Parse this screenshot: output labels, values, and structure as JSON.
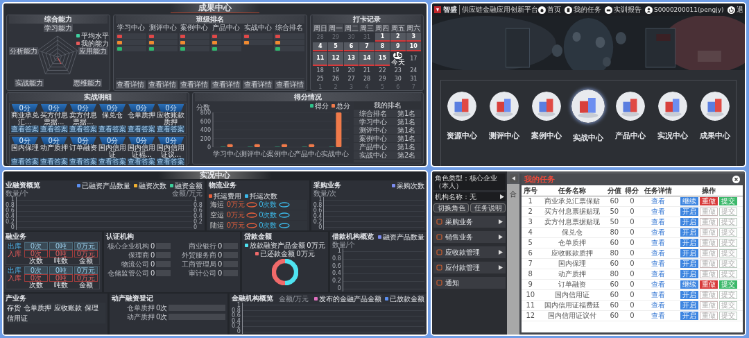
{
  "achievement": {
    "title": "成果中心",
    "ability": {
      "title": "综合能力",
      "axes": [
        "学习能力",
        "应用能力",
        "思维能力",
        "实战能力",
        "分析能力"
      ],
      "legend": [
        {
          "label": "平均水平",
          "color": "#3fd0a0"
        },
        {
          "label": "我的能力",
          "color": "#e85a5a"
        }
      ]
    },
    "class_rank": {
      "title": "班级排名",
      "columns": [
        {
          "heading": "学习中心",
          "ranks": [
            {
              "color": "#e04848"
            },
            {
              "color": "#f08a30"
            },
            {
              "color": "#2fb86e"
            }
          ],
          "button": "查看详情"
        },
        {
          "heading": "测评中心",
          "ranks": [
            {
              "color": "#e04848"
            },
            {
              "color": "#f08a30"
            },
            {
              "color": "#2fb86e"
            }
          ],
          "button": "查看详情"
        },
        {
          "heading": "案例中心",
          "ranks": [
            {
              "color": "#e04848"
            },
            {
              "color": "#f08a30"
            },
            {
              "color": "#2fb86e"
            }
          ],
          "button": "查看详情"
        },
        {
          "heading": "产品中心",
          "ranks": [
            {
              "color": "#e04848"
            },
            {
              "color": "#f08a30"
            },
            {
              "color": "#2fb86e"
            }
          ],
          "button": "查看详情"
        },
        {
          "heading": "实战中心",
          "ranks": [
            {
              "color": "#e04848"
            },
            {
              "color": "#f08a30"
            }
          ],
          "button": "查看详情"
        },
        {
          "heading": "综合排名",
          "ranks": [
            {
              "color": "#e04848"
            },
            {
              "color": "#f08a30"
            },
            {
              "color": "#2fb86e"
            }
          ],
          "button": "查看详情"
        }
      ]
    },
    "checkin": {
      "title": "打卡记录",
      "weekdays": [
        "周日",
        "周一",
        "周二",
        "周三",
        "周四",
        "周五",
        "周六"
      ],
      "days": [
        {
          "label": "28",
          "kind": "other"
        },
        {
          "label": "29",
          "kind": "other"
        },
        {
          "label": "30",
          "kind": "other"
        },
        {
          "label": "31",
          "kind": "other"
        },
        {
          "label": "1",
          "kind": "checked"
        },
        {
          "label": "2",
          "kind": "checked"
        },
        {
          "label": "3",
          "kind": "checked"
        },
        {
          "label": "4",
          "kind": "checked"
        },
        {
          "label": "5",
          "kind": "checked"
        },
        {
          "label": "6",
          "kind": "checked"
        },
        {
          "label": "7",
          "kind": "checked"
        },
        {
          "label": "8",
          "kind": "checked"
        },
        {
          "label": "9",
          "kind": "checked"
        },
        {
          "label": "10",
          "kind": "checked"
        },
        {
          "label": "11",
          "kind": "checked"
        },
        {
          "label": "12",
          "kind": "checked"
        },
        {
          "label": "13",
          "kind": "checked"
        },
        {
          "label": "14",
          "kind": "checked"
        },
        {
          "label": "15",
          "kind": "checked"
        },
        {
          "label": "16",
          "kind": "today",
          "note": "今天"
        },
        {
          "label": "17",
          "kind": "normal"
        },
        {
          "label": "18",
          "kind": "normal"
        },
        {
          "label": "19",
          "kind": "normal"
        },
        {
          "label": "20",
          "kind": "normal"
        },
        {
          "label": "21",
          "kind": "normal"
        },
        {
          "label": "22",
          "kind": "normal"
        },
        {
          "label": "23",
          "kind": "normal"
        },
        {
          "label": "24",
          "kind": "normal"
        },
        {
          "label": "25",
          "kind": "normal"
        },
        {
          "label": "26",
          "kind": "normal"
        },
        {
          "label": "27",
          "kind": "normal"
        },
        {
          "label": "28",
          "kind": "normal"
        },
        {
          "label": "29",
          "kind": "normal"
        },
        {
          "label": "30",
          "kind": "normal"
        },
        {
          "label": "31",
          "kind": "normal"
        },
        {
          "label": "1",
          "kind": "other"
        },
        {
          "label": "2",
          "kind": "other"
        },
        {
          "label": "3",
          "kind": "other"
        },
        {
          "label": "4",
          "kind": "other"
        },
        {
          "label": "5",
          "kind": "other"
        },
        {
          "label": "6",
          "kind": "other"
        },
        {
          "label": "7",
          "kind": "other"
        }
      ]
    },
    "practice": {
      "title": "实战明细",
      "groups": [
        [
          {
            "score": "0分",
            "name": "商业承兑汇...",
            "button": "查看答案"
          },
          {
            "score": "0分",
            "name": "买方付息票据...",
            "button": "查看答案"
          },
          {
            "score": "0分",
            "name": "卖方付息票据...",
            "button": "查看答案"
          },
          {
            "score": "0分",
            "name": "保兑仓",
            "button": "查看答案"
          },
          {
            "score": "0分",
            "name": "仓单质押",
            "button": "查看答案"
          },
          {
            "score": "0分",
            "name": "应收账款质押",
            "button": "查看答案"
          }
        ],
        [
          {
            "score": "0分",
            "name": "国内保理",
            "button": "查看答案"
          },
          {
            "score": "0分",
            "name": "动产质押",
            "button": "查看答案"
          },
          {
            "score": "0分",
            "name": "订单融资",
            "button": "查看答案"
          },
          {
            "score": "0分",
            "name": "国内信用证",
            "button": "查看答案"
          },
          {
            "score": "0分",
            "name": "国内信用证福...",
            "button": "查看答案"
          },
          {
            "score": "0分",
            "name": "国内信用证议...",
            "button": "查看答案"
          }
        ]
      ]
    },
    "score": {
      "title": "得分情况",
      "chart_data": {
        "type": "bar",
        "ylabel": "分数",
        "categories": [
          "学习中心",
          "测评中心",
          "案例中心",
          "产品中心",
          "实战中心"
        ],
        "ylim": [
          0,
          800
        ],
        "yticks": [
          0,
          200,
          400,
          600,
          800
        ],
        "series": [
          {
            "name": "得分",
            "color": "#2fc28a",
            "values": [
              10,
              10,
              10,
              10,
              10
            ]
          },
          {
            "name": "总分",
            "color": "#f07a4a",
            "values": [
              70,
              70,
              70,
              70,
              800
            ]
          }
        ]
      },
      "rank_table": {
        "heading": "我的排名",
        "rows": [
          {
            "center": "综合排名",
            "rank": "第1名"
          },
          {
            "center": "学习中心",
            "rank": "第1名"
          },
          {
            "center": "测评中心",
            "rank": "第1名"
          },
          {
            "center": "案例中心",
            "rank": "第1名"
          },
          {
            "center": "产品中心",
            "rank": "第1名"
          },
          {
            "center": "实战中心",
            "rank": "第2名"
          }
        ]
      }
    }
  },
  "home": {
    "logo": "智盛",
    "platform": "供应链金融应用创新平台",
    "nav": [
      {
        "label": "首页",
        "kind": "home"
      },
      {
        "label": "我的任务",
        "kind": "task"
      },
      {
        "label": "实训报告",
        "kind": "report"
      },
      {
        "label": "S0000200011(pengjy)",
        "kind": "user"
      },
      {
        "label": "退",
        "kind": "logout"
      }
    ],
    "centers": [
      {
        "label": "资源中心",
        "selected": false
      },
      {
        "label": "测评中心",
        "selected": false
      },
      {
        "label": "案例中心",
        "selected": false
      },
      {
        "label": "实战中心",
        "selected": true
      },
      {
        "label": "产品中心",
        "selected": false
      },
      {
        "label": "实况中心",
        "selected": false
      },
      {
        "label": "成果中心",
        "selected": false
      }
    ]
  },
  "live": {
    "title": "实况中心",
    "rows": [
      [
        {
          "kind": "chart",
          "title": "业融资概览",
          "legend": [
            {
              "label": "已融资产品数量",
              "color": "#5b8ff0"
            },
            {
              "label": "融资次数",
              "color": "#f0b030"
            },
            {
              "label": "融资金额",
              "color": "#3ccf9a"
            }
          ],
          "axis": {
            "label": "数量/个",
            "ticks": [
              "1",
              "0.8",
              "0.6",
              "0.4",
              "0.2",
              "0"
            ]
          },
          "right_axis": {
            "label": "金额/万元",
            "ticks": [
              "1",
              "0.8",
              "0.6",
              "0.4",
              "0.2",
              "0"
            ]
          }
        },
        {
          "kind": "logistics",
          "title": "物流业务",
          "legend": [
            {
              "label": "托运费用",
              "color": "#e8603c"
            },
            {
              "label": "托运次数",
              "color": "#3cb8e8"
            }
          ],
          "rows": [
            {
              "label": "海运",
              "cost": "0万元",
              "count": "0次数"
            },
            {
              "label": "空运",
              "cost": "0万元",
              "count": "0次数"
            },
            {
              "label": "陆运",
              "cost": "0万元",
              "count": "0次数"
            }
          ]
        },
        {
          "kind": "chart",
          "title": "采购业务",
          "legend": [
            {
              "label": "采购次数",
              "color": "#7c8cf0"
            }
          ],
          "axis": {
            "label": "数量/次",
            "ticks": [
              "1",
              "0.8",
              "0.6",
              "0.4",
              "0.2",
              "0"
            ]
          }
        }
      ],
      [
        {
          "kind": "warehouse",
          "title": "融业务",
          "groups": [
            {
              "rows": [
                {
                  "label": "出库",
                  "kind": "out",
                  "values": [
                    "0次",
                    "0吨",
                    "0万元"
                  ]
                },
                {
                  "label": "入库",
                  "kind": "in",
                  "values": [
                    "0次",
                    "0吨",
                    "0万元"
                  ]
                }
              ],
              "captions": [
                "次数",
                "吨数",
                "金额"
              ]
            },
            {
              "rows": [
                {
                  "label": "出库",
                  "kind": "out",
                  "values": [
                    "0次",
                    "0吨",
                    "0万元"
                  ]
                },
                {
                  "label": "入库",
                  "kind": "in",
                  "values": [
                    "0次",
                    "0吨",
                    "0万元"
                  ]
                }
              ],
              "captions": [
                "次数",
                "吨数",
                "金额"
              ]
            }
          ]
        },
        {
          "kind": "bars",
          "title": "认证机构",
          "rows": [
            {
              "label": "核心企业机构",
              "value": "0"
            },
            {
              "label": "保理商",
              "value": "0"
            },
            {
              "label": "物流公司",
              "value": "0"
            },
            {
              "label": "仓储监管公司",
              "value": "0"
            },
            {
              "label": "商业银行",
              "value": "0"
            },
            {
              "label": "外贸服务商",
              "value": "0"
            },
            {
              "label": "工商管理局",
              "value": "0"
            },
            {
              "label": "审计公司",
              "value": "0"
            }
          ]
        },
        {
          "kind": "donut",
          "title": "贷款金额",
          "legend": [
            {
              "label": "放款融资产品金额",
              "value": "0万元",
              "color": "#4fe3f0"
            },
            {
              "label": "已还款金额",
              "value": "0万元",
              "color": "#f06a6a"
            }
          ]
        },
        {
          "kind": "chart",
          "title": "借款机构概览",
          "legend": [
            {
              "label": "融资产品数量",
              "color": "#7c8cf0"
            }
          ],
          "axis": {
            "label": "数量/个",
            "ticks": [
              "1",
              "0.8",
              "0.6",
              "0.4",
              "0.2",
              "0"
            ]
          }
        }
      ],
      [
        {
          "kind": "table",
          "title": "产业务",
          "columns": [
            "存货",
            "仓单质押",
            "应收账款",
            "保理",
            "信用证"
          ]
        },
        {
          "kind": "bars",
          "title": "动产融资登记",
          "rows": [
            {
              "label": "仓单质押",
              "value": "0次"
            },
            {
              "label": "动产质押",
              "value": "0次"
            }
          ]
        },
        {
          "kind": "chart",
          "title": "金融机构概览",
          "legend": [
            {
              "label": "发布的金融产品金额",
              "color": "#e070c0"
            },
            {
              "label": "已放款金额",
              "color": "#5b8ff0"
            }
          ],
          "axis": {
            "label": "金额/万元",
            "ticks": [
              "1",
              "0.8",
              "0.6",
              "0.4",
              "0.2",
              "0"
            ]
          }
        }
      ]
    ]
  },
  "tasks": {
    "role": "角色类型：核心企业（本人）",
    "org": "机构名称：无",
    "buttons": [
      "切换角色",
      "任务说明"
    ],
    "menu": [
      {
        "label": "采购业务",
        "expandable": true
      },
      {
        "label": "销售业务",
        "expandable": true
      },
      {
        "label": "应收款管理",
        "expandable": true
      },
      {
        "label": "应付款管理",
        "expandable": true
      },
      {
        "label": "通知",
        "expandable": false
      }
    ],
    "behind_text": "合",
    "modal": {
      "title": "我的任务",
      "columns": [
        "序号",
        "任务名称",
        "分值",
        "得分",
        "任务详情",
        "操作"
      ],
      "rows": [
        {
          "no": "1",
          "name": "商业承兑汇票保贴",
          "value": "60",
          "score": "0",
          "detail": "查看",
          "actions": [
            {
              "label": "继续",
              "kind": "primary",
              "disabled": false
            },
            {
              "label": "重做",
              "kind": "danger",
              "disabled": false
            },
            {
              "label": "提交",
              "kind": "success",
              "disabled": false
            }
          ]
        },
        {
          "no": "2",
          "name": "买方付息票据贴现",
          "value": "50",
          "score": "0",
          "detail": "查看",
          "actions": [
            {
              "label": "开启",
              "kind": "primary",
              "disabled": false
            },
            {
              "label": "重做",
              "kind": "danger",
              "disabled": true
            },
            {
              "label": "提交",
              "kind": "success",
              "disabled": true
            }
          ]
        },
        {
          "no": "3",
          "name": "卖方付息票据贴现",
          "value": "50",
          "score": "0",
          "detail": "查看",
          "actions": [
            {
              "label": "开启",
              "kind": "primary",
              "disabled": false
            },
            {
              "label": "重做",
              "kind": "danger",
              "disabled": true
            },
            {
              "label": "提交",
              "kind": "success",
              "disabled": true
            }
          ]
        },
        {
          "no": "4",
          "name": "保兑仓",
          "value": "80",
          "score": "0",
          "detail": "查看",
          "actions": [
            {
              "label": "开启",
              "kind": "primary",
              "disabled": false
            },
            {
              "label": "重做",
              "kind": "danger",
              "disabled": true
            },
            {
              "label": "提交",
              "kind": "success",
              "disabled": true
            }
          ]
        },
        {
          "no": "5",
          "name": "仓单质押",
          "value": "60",
          "score": "0",
          "detail": "查看",
          "actions": [
            {
              "label": "开启",
              "kind": "primary",
              "disabled": false
            },
            {
              "label": "重做",
              "kind": "danger",
              "disabled": true
            },
            {
              "label": "提交",
              "kind": "success",
              "disabled": true
            }
          ]
        },
        {
          "no": "6",
          "name": "应收账款质押",
          "value": "80",
          "score": "0",
          "detail": "查看",
          "actions": [
            {
              "label": "开启",
              "kind": "primary",
              "disabled": false
            },
            {
              "label": "重做",
              "kind": "danger",
              "disabled": true
            },
            {
              "label": "提交",
              "kind": "success",
              "disabled": true
            }
          ]
        },
        {
          "no": "7",
          "name": "国内保理",
          "value": "60",
          "score": "0",
          "detail": "查看",
          "actions": [
            {
              "label": "开启",
              "kind": "primary",
              "disabled": false
            },
            {
              "label": "重做",
              "kind": "danger",
              "disabled": true
            },
            {
              "label": "提交",
              "kind": "success",
              "disabled": true
            }
          ]
        },
        {
          "no": "8",
          "name": "动产质押",
          "value": "80",
          "score": "0",
          "detail": "查看",
          "actions": [
            {
              "label": "开启",
              "kind": "primary",
              "disabled": false
            },
            {
              "label": "重做",
              "kind": "danger",
              "disabled": true
            },
            {
              "label": "提交",
              "kind": "success",
              "disabled": true
            }
          ]
        },
        {
          "no": "9",
          "name": "订单融资",
          "value": "60",
          "score": "0",
          "detail": "查看",
          "actions": [
            {
              "label": "继续",
              "kind": "primary",
              "disabled": false
            },
            {
              "label": "重做",
              "kind": "danger",
              "disabled": false
            },
            {
              "label": "提交",
              "kind": "success",
              "disabled": false
            }
          ]
        },
        {
          "no": "10",
          "name": "国内信用证",
          "value": "60",
          "score": "0",
          "detail": "查看",
          "actions": [
            {
              "label": "开启",
              "kind": "primary",
              "disabled": false
            },
            {
              "label": "重做",
              "kind": "danger",
              "disabled": true
            },
            {
              "label": "提交",
              "kind": "success",
              "disabled": true
            }
          ]
        },
        {
          "no": "11",
          "name": "国内信用证福费廷",
          "value": "60",
          "score": "0",
          "detail": "查看",
          "actions": [
            {
              "label": "开启",
              "kind": "primary",
              "disabled": false
            },
            {
              "label": "重做",
              "kind": "danger",
              "disabled": true
            },
            {
              "label": "提交",
              "kind": "success",
              "disabled": true
            }
          ]
        },
        {
          "no": "12",
          "name": "国内信用证议付",
          "value": "60",
          "score": "0",
          "detail": "查看",
          "actions": [
            {
              "label": "开启",
              "kind": "primary",
              "disabled": false
            },
            {
              "label": "重做",
              "kind": "danger",
              "disabled": true
            },
            {
              "label": "提交",
              "kind": "success",
              "disabled": true
            }
          ]
        }
      ]
    }
  }
}
